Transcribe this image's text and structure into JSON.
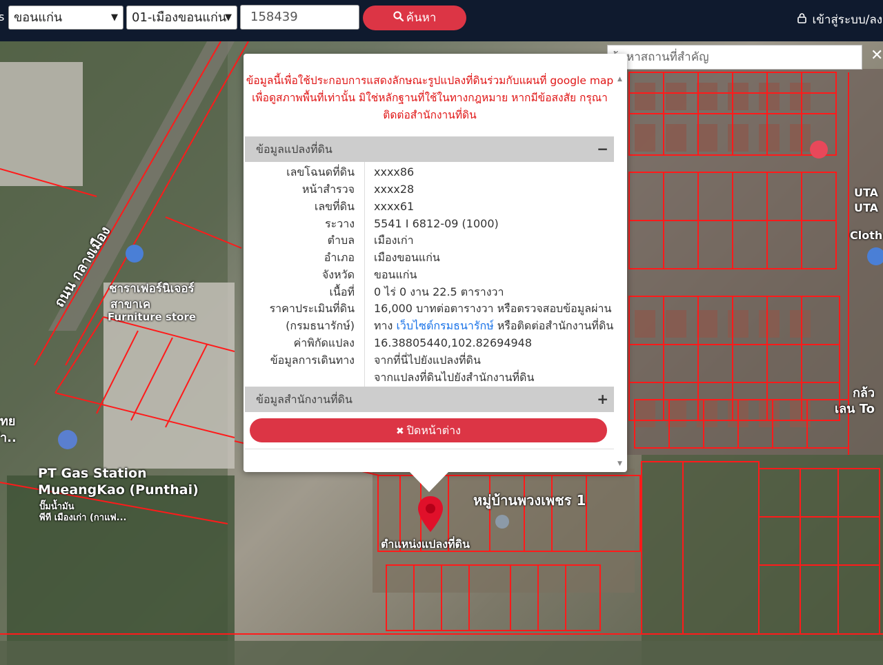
{
  "topbar": {
    "left_fragment": "s",
    "province": {
      "value": "ขอนแก่น"
    },
    "district": {
      "value": "01-เมืองขอนแก่น"
    },
    "deed_input": {
      "value": "158439"
    },
    "search_button": {
      "label": "ค้นหา",
      "icon": "search-icon"
    },
    "login": {
      "label": "เข้าสู่ระบบ/ลง",
      "icon": "lock-icon"
    }
  },
  "map": {
    "place_search": {
      "placeholder": "ค้นหาสถานที่สำคัญ"
    },
    "close_symbol": "✕",
    "labels": {
      "road": "ถนน กลางเมือง",
      "furniture_1": "ชาราเฟอร์นิเจอร์",
      "furniture_2": "สาขาเค",
      "furniture_3": "Furniture store",
      "gas_1": "PT Gas Station",
      "gas_2": "MueangKao (Punthai)",
      "gas_3": "ปั๊มน้ำมัน",
      "gas_4": "พีที เมืองเก่า (กาแฟ...",
      "village": "หมู่บ้านพวงเพชร 1",
      "parcel_location": "ตำแหน่งแปลงที่ดิน",
      "left_edge_1": "ทย",
      "left_edge_2": "ำ..",
      "right_edge_1": "UTA",
      "right_edge_2": "UTA",
      "right_edge_3": "Cloth",
      "right_edge_4": "กล้ว",
      "right_edge_5": "เลน To"
    }
  },
  "popup": {
    "disclaimer_1": "ข้อมูลนี้เพื่อใช้ประกอบการแสดงลักษณะรูปแปลงที่ดินร่วมกับแผนที่ google map",
    "disclaimer_2": "เพื่อดูสภาพพื้นที่เท่านั้น มิใช่หลักฐานที่ใช้ในทางกฎหมาย หากมีข้อสงสัย กรุณา",
    "disclaimer_3": "ติดต่อสำนักงานที่ดิน",
    "section_land": {
      "title": "ข้อมูลแปลงที่ดิน",
      "toggle": "−"
    },
    "fields": {
      "deed_no": {
        "label": "เลขโฉนดที่ดิน",
        "value": "xxxx86"
      },
      "survey_page": {
        "label": "หน้าสำรวจ",
        "value": "xxxx28"
      },
      "land_no": {
        "label": "เลขที่ดิน",
        "value": "xxxx61"
      },
      "sheet": {
        "label": "ระวาง",
        "value": "5541 I 6812-09 (1000)"
      },
      "subdistrict": {
        "label": "ตำบล",
        "value": "เมืองเก่า"
      },
      "district": {
        "label": "อำเภอ",
        "value": "เมืองขอนแก่น"
      },
      "province": {
        "label": "จังหวัด",
        "value": "ขอนแก่น"
      },
      "area": {
        "label": "เนื้อที่",
        "value": "0 ไร่ 0 งาน 22.5 ตารางวา"
      },
      "appraisal": {
        "label_1": "ราคาประเมินที่ดิน",
        "label_2": "(กรมธนารักษ์)",
        "value_1": "16,000 บาทต่อตารางวา หรือตรวจสอบข้อมูลผ่าน",
        "value_2a": "ทาง",
        "value_2_link": "เว็บไซต์กรมธนารักษ์",
        "value_2b": "หรือติดต่อสำนักงานที่ดิน"
      },
      "coords": {
        "label": "ค่าพิกัดแปลง",
        "value": "16.38805440,102.82694948"
      },
      "directions": {
        "label": "ข้อมูลการเดินทาง",
        "link_1": "จากที่นี่ไปยังแปลงที่ดิน",
        "link_2": "จากแปลงที่ดินไปยังสำนักงานที่ดิน"
      }
    },
    "section_office": {
      "title": "ข้อมูลสำนักงานที่ดิน",
      "toggle": "+"
    },
    "close_button": {
      "label": "ปิดหน้าต่าง",
      "icon": "close-icon"
    }
  },
  "colors": {
    "accent": "#dc3545",
    "topbar": "#0f1a2e",
    "parcel_lines": "#ff1a1a",
    "link": "#1a73e8"
  }
}
